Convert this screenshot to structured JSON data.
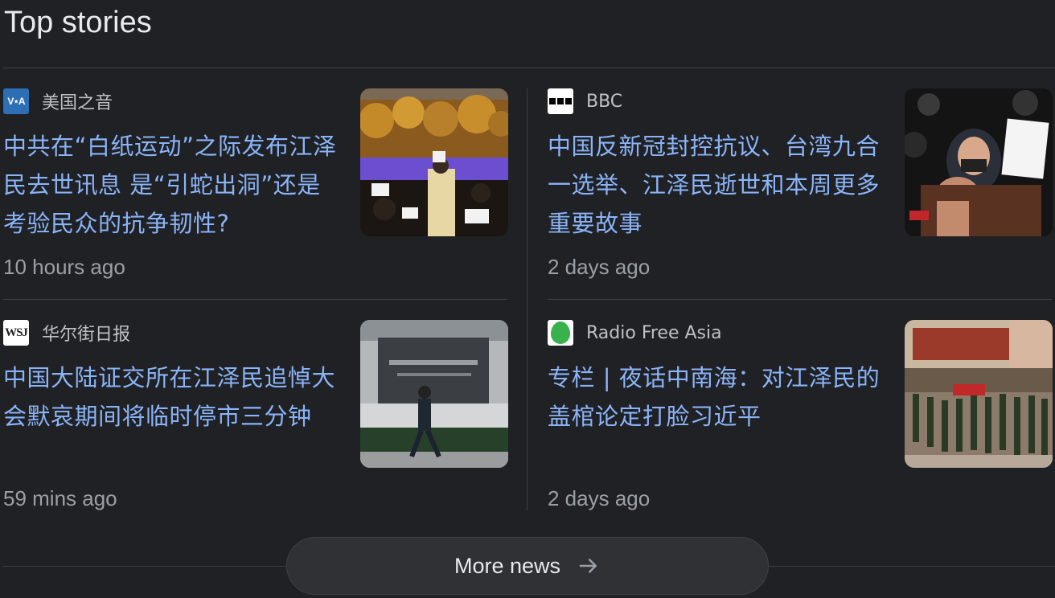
{
  "section": {
    "title": "Top stories"
  },
  "stories": [
    {
      "source": "美国之音",
      "logo": "voa-logo",
      "logo_text": "V⋆A",
      "headline": "中共在“白纸运动”之际发布江泽民去世讯息 是“引蛇出洞”还是考验民众的抗争韧性?",
      "time": "10 hours ago"
    },
    {
      "source": "BBC",
      "logo": "bbc-logo",
      "headline": "中国反新冠封控抗议、台湾九合一选举、江泽民逝世和本周更多重要故事",
      "time": "2 days ago"
    },
    {
      "source": "华尔街日报",
      "logo": "wsj-logo",
      "logo_text": "WSJ",
      "headline": "中国大陆证交所在江泽民追悼大会默哀期间将临时停市三分钟",
      "time": "59 mins ago"
    },
    {
      "source": "Radio Free Asia",
      "logo": "rfa-logo",
      "headline": "专栏 | 夜话中南海：对江泽民的盖棺论定打脸习近平",
      "time": "2 days ago"
    }
  ],
  "more_news": {
    "label": "More news",
    "icon": "arrow-right-icon"
  },
  "colors": {
    "background": "#202124",
    "headline": "#8ab4f8",
    "meta": "#9aa0a6",
    "divider": "#3c4043"
  }
}
